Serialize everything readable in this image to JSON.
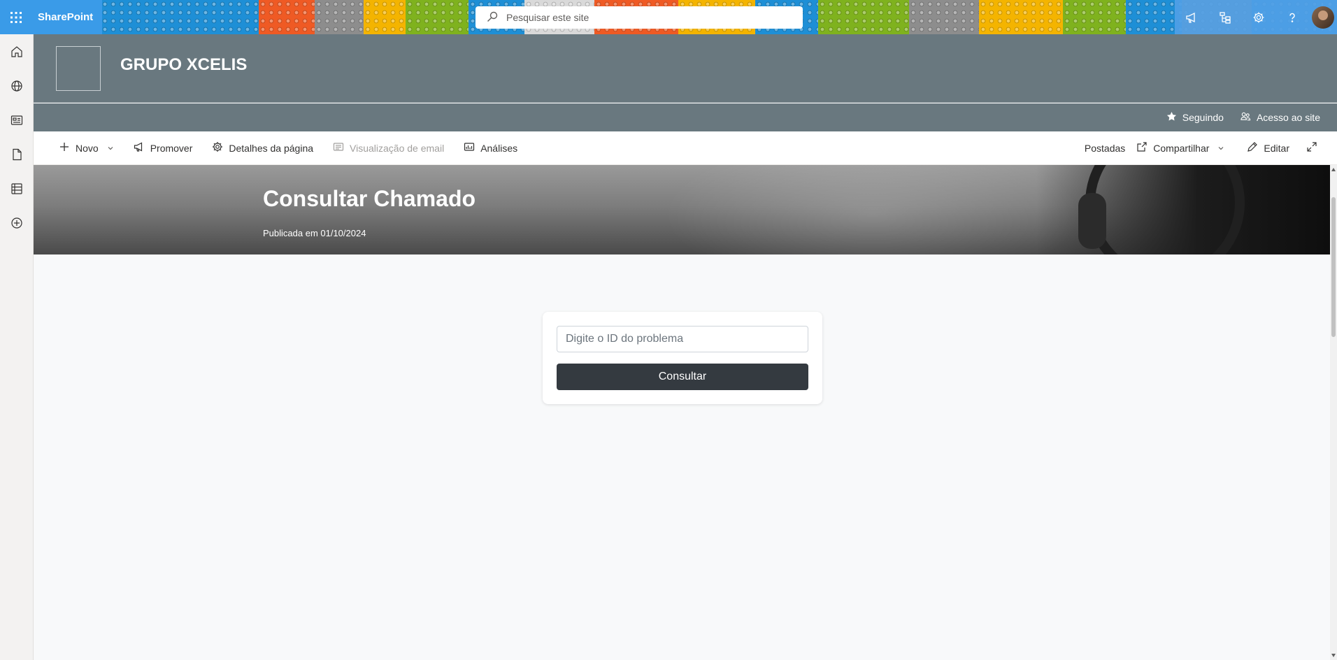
{
  "suite": {
    "brand": "SharePoint",
    "search_placeholder": "Pesquisar este site",
    "icons": [
      "waffle-icon",
      "megaphone-icon",
      "org-chart-icon",
      "gear-icon",
      "help-icon"
    ]
  },
  "appbar": {
    "items": [
      "home-icon",
      "globe-icon",
      "news-icon",
      "document-icon",
      "list-icon",
      "add-icon"
    ]
  },
  "site": {
    "title": "GRUPO XCELIS",
    "following_label": "Seguindo",
    "access_label": "Acesso ao site"
  },
  "commands": {
    "new": "Novo",
    "promote": "Promover",
    "page_details": "Detalhes da página",
    "email_preview": "Visualização de email",
    "analytics": "Análises",
    "posted": "Postadas",
    "share": "Compartilhar",
    "edit": "Editar"
  },
  "banner": {
    "title": "Consultar Chamado",
    "published": "Publicada em 01/10/2024"
  },
  "form": {
    "id_placeholder": "Digite o ID do problema",
    "id_value": "",
    "submit_label": "Consultar"
  },
  "colors": {
    "header_bg": "#69787f",
    "button_bg": "#343a40",
    "page_bg": "#f8f9fa",
    "suite_accent": "#1e8fd6"
  }
}
